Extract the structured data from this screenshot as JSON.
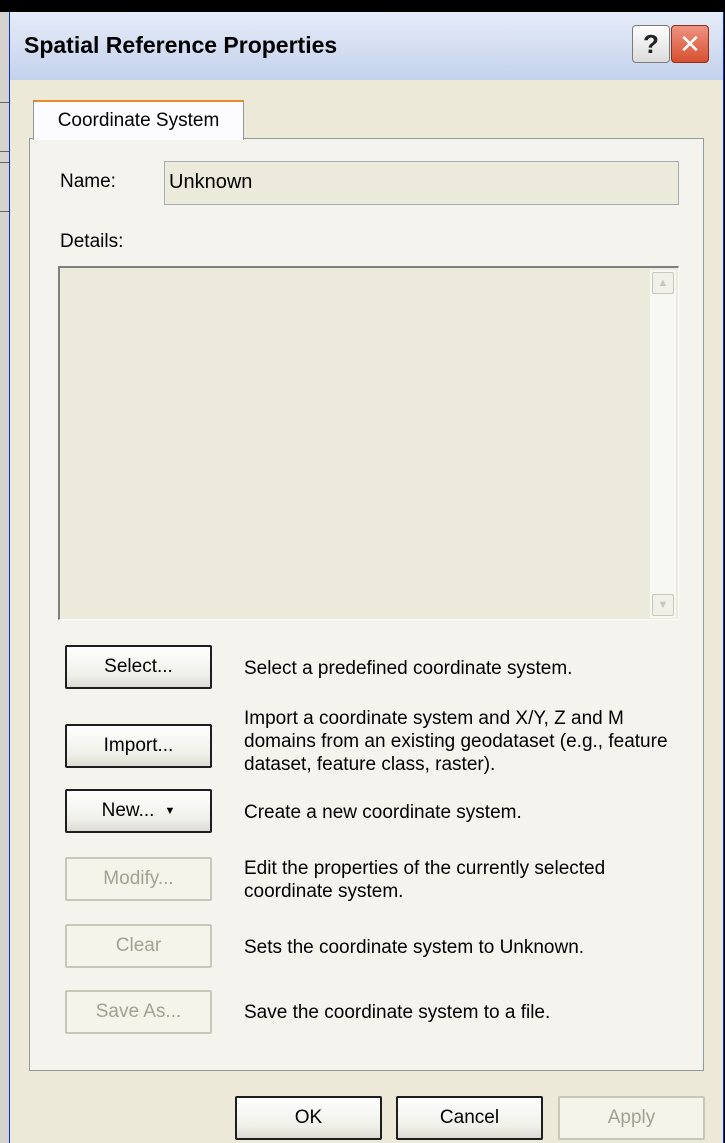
{
  "window": {
    "title": "Spatial Reference Properties",
    "help_glyph": "?",
    "close_glyph": "✕"
  },
  "tabs": [
    {
      "label": "Coordinate System",
      "selected": true
    }
  ],
  "name_field": {
    "label": "Name:",
    "value": "Unknown"
  },
  "details": {
    "label": "Details:",
    "content": ""
  },
  "actions": [
    {
      "button": "Select...",
      "description": "Select a predefined coordinate system.",
      "enabled": true
    },
    {
      "button": "Import...",
      "description": "Import a coordinate system and X/Y, Z and M domains from an existing geodataset (e.g., feature dataset, feature class, raster).",
      "enabled": true
    },
    {
      "button": "New...",
      "has_dropdown": true,
      "description": "Create a new coordinate system.",
      "enabled": true
    },
    {
      "button": "Modify...",
      "description": "Edit the properties of the currently selected coordinate system.",
      "enabled": false
    },
    {
      "button": "Clear",
      "description": "Sets the coordinate system to Unknown.",
      "enabled": false
    },
    {
      "button": "Save As...",
      "description": "Save the coordinate system to a file.",
      "enabled": false
    }
  ],
  "footer": {
    "ok": "OK",
    "cancel": "Cancel",
    "apply": "Apply"
  },
  "colors": {
    "title_bar": "#d5dff2",
    "dialog_bg": "#ece9d8",
    "tab_highlight": "#e68b2c",
    "close_button": "#d6502f"
  }
}
